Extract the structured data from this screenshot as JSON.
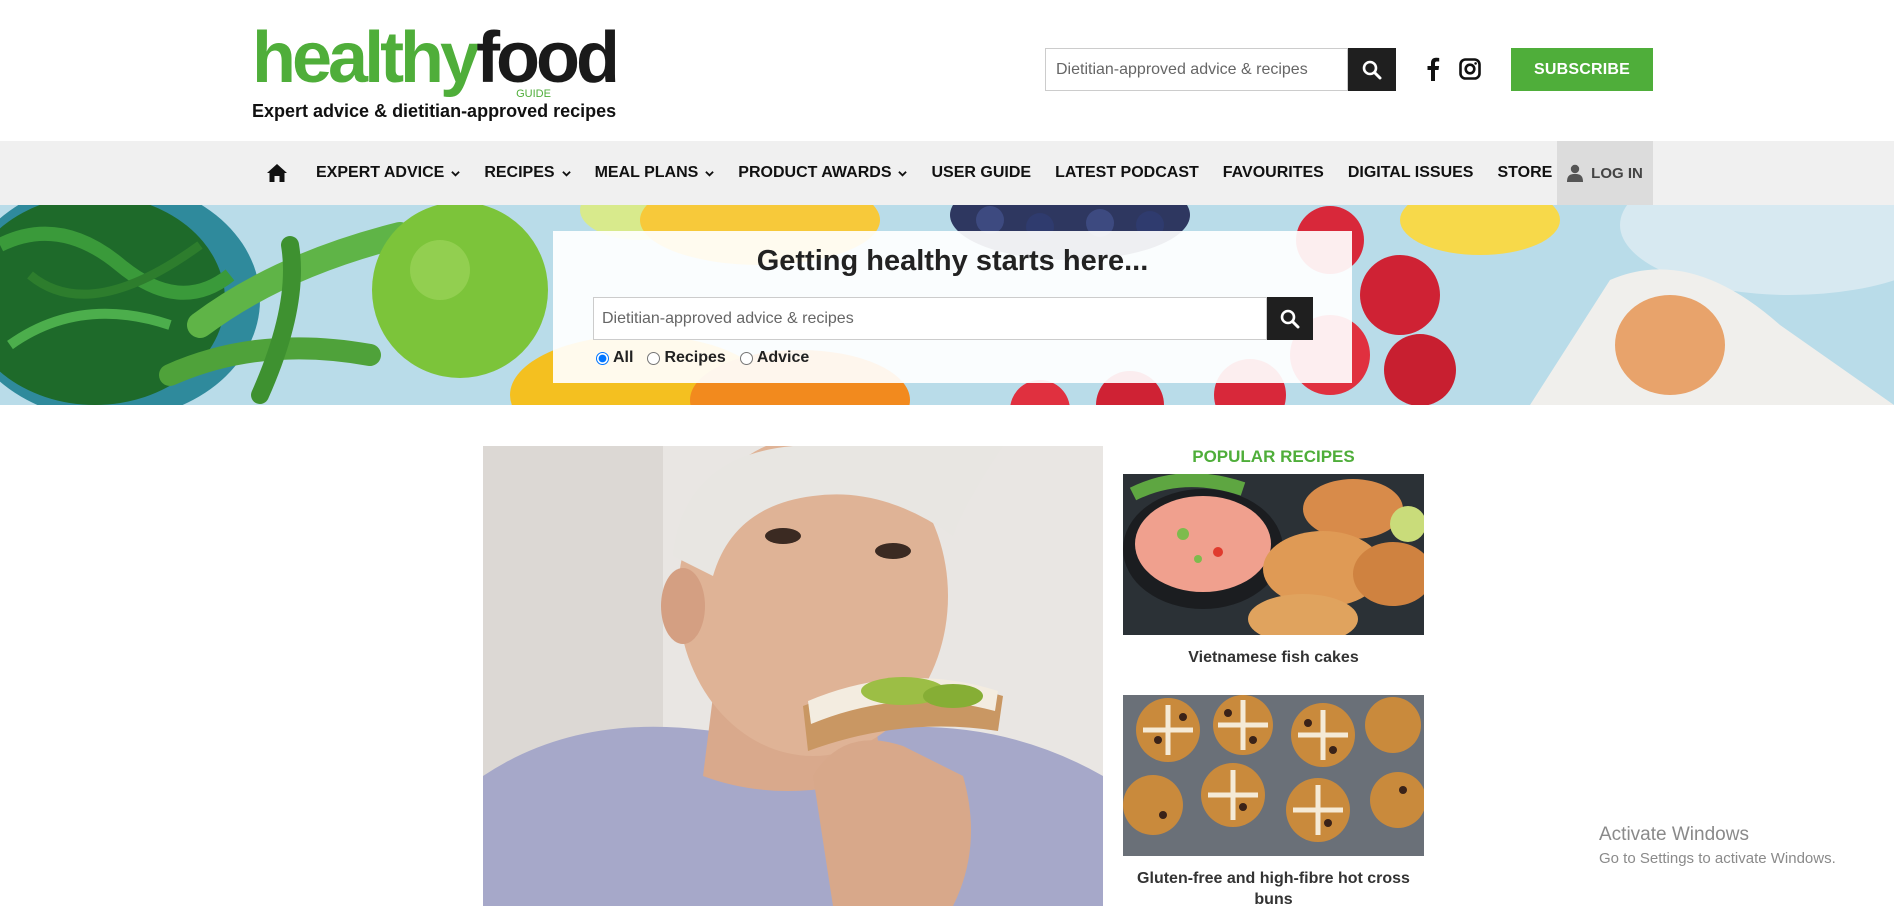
{
  "header": {
    "logo_part1": "healthy",
    "logo_part2": "food",
    "logo_small": "GUIDE",
    "tagline": "Expert advice & dietitian-approved recipes",
    "search_placeholder": "Dietitian-approved advice & recipes",
    "subscribe_label": "SUBSCRIBE"
  },
  "nav": {
    "items": [
      {
        "label": "EXPERT ADVICE",
        "has_dropdown": true
      },
      {
        "label": "RECIPES",
        "has_dropdown": true
      },
      {
        "label": "MEAL PLANS",
        "has_dropdown": true
      },
      {
        "label": "PRODUCT AWARDS",
        "has_dropdown": true
      },
      {
        "label": "USER GUIDE",
        "has_dropdown": false
      },
      {
        "label": "LATEST PODCAST",
        "has_dropdown": false
      },
      {
        "label": "FAVOURITES",
        "has_dropdown": false
      },
      {
        "label": "DIGITAL ISSUES",
        "has_dropdown": false
      },
      {
        "label": "STORE",
        "has_dropdown": false
      }
    ],
    "login_label": "LOG IN"
  },
  "hero": {
    "title": "Getting healthy starts here...",
    "search_placeholder": "Dietitian-approved advice & recipes",
    "filters": [
      {
        "label": "All",
        "checked": true
      },
      {
        "label": "Recipes",
        "checked": false
      },
      {
        "label": "Advice",
        "checked": false
      }
    ]
  },
  "popular": {
    "title": "POPULAR RECIPES",
    "recipes": [
      {
        "title": "Vietnamese fish cakes"
      },
      {
        "title": "Gluten-free and high-fibre hot cross buns"
      }
    ]
  },
  "watermark": {
    "line1": "Activate Windows",
    "line2": "Go to Settings to activate Windows."
  },
  "colors": {
    "brand_green": "#4fae3a",
    "dark": "#1f1f1f",
    "nav_bg": "#f0f0f0"
  }
}
